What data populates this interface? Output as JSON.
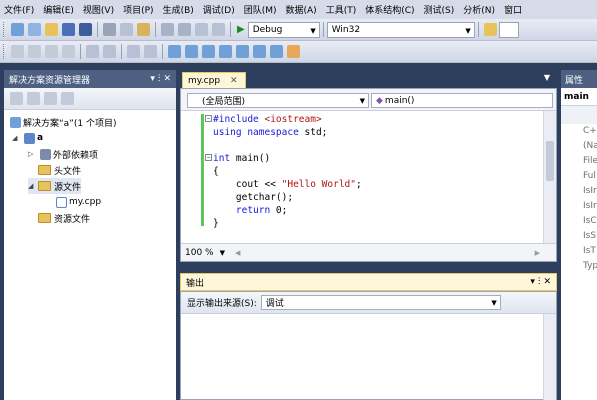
{
  "menu": [
    "文件(F)",
    "编辑(E)",
    "视图(V)",
    "项目(P)",
    "生成(B)",
    "调试(D)",
    "团队(M)",
    "数据(A)",
    "工具(T)",
    "体系结构(C)",
    "测试(S)",
    "分析(N)",
    "窗口"
  ],
  "toolbar": {
    "config": "Debug",
    "platform": "Win32"
  },
  "solution_explorer": {
    "title": "解决方案资源管理器",
    "pin": "▾ ⵗ ✕",
    "items": [
      {
        "label": "解决方案“a”(1 个项目)",
        "depth": 0,
        "expander": ""
      },
      {
        "label": "a",
        "depth": 1,
        "expander": "◢"
      },
      {
        "label": "外部依赖项",
        "depth": 2,
        "expander": "▷"
      },
      {
        "label": "头文件",
        "depth": 2,
        "expander": ""
      },
      {
        "label": "源文件",
        "depth": 2,
        "expander": "◢"
      },
      {
        "label": "my.cpp",
        "depth": 3,
        "expander": ""
      },
      {
        "label": "资源文件",
        "depth": 2,
        "expander": ""
      }
    ]
  },
  "editor": {
    "tab_label": "my.cpp",
    "scope": "(全局范围)",
    "member": "main()",
    "zoom": "100 %",
    "code": [
      {
        "parts": [
          [
            "kw",
            "#include "
          ],
          [
            "str",
            "<iostream>"
          ]
        ]
      },
      {
        "parts": [
          [
            "kw",
            "using namespace "
          ],
          [
            "",
            "std;"
          ]
        ]
      },
      {
        "parts": [
          [
            "",
            ""
          ]
        ]
      },
      {
        "parts": [
          [
            "kw",
            "int "
          ],
          [
            "",
            "main()"
          ]
        ]
      },
      {
        "parts": [
          [
            "",
            "{"
          ]
        ]
      },
      {
        "parts": [
          [
            "",
            "    cout << "
          ],
          [
            "str",
            "\"Hello World\""
          ],
          [
            "",
            ";"
          ]
        ]
      },
      {
        "parts": [
          [
            "",
            "    getchar();"
          ]
        ]
      },
      {
        "parts": [
          [
            "kw",
            "    return "
          ],
          [
            "",
            "0;"
          ]
        ]
      },
      {
        "parts": [
          [
            "",
            "}"
          ]
        ]
      }
    ]
  },
  "output": {
    "title": "输出",
    "source_label": "显示输出来源(S):",
    "source_value": "调试"
  },
  "properties": {
    "title": "属性",
    "header": "main",
    "rows": [
      "C+",
      "(Na",
      "File",
      "Ful",
      "IsIr",
      "IsIr",
      "IsC",
      "IsS",
      "IsT",
      "Typ"
    ]
  }
}
